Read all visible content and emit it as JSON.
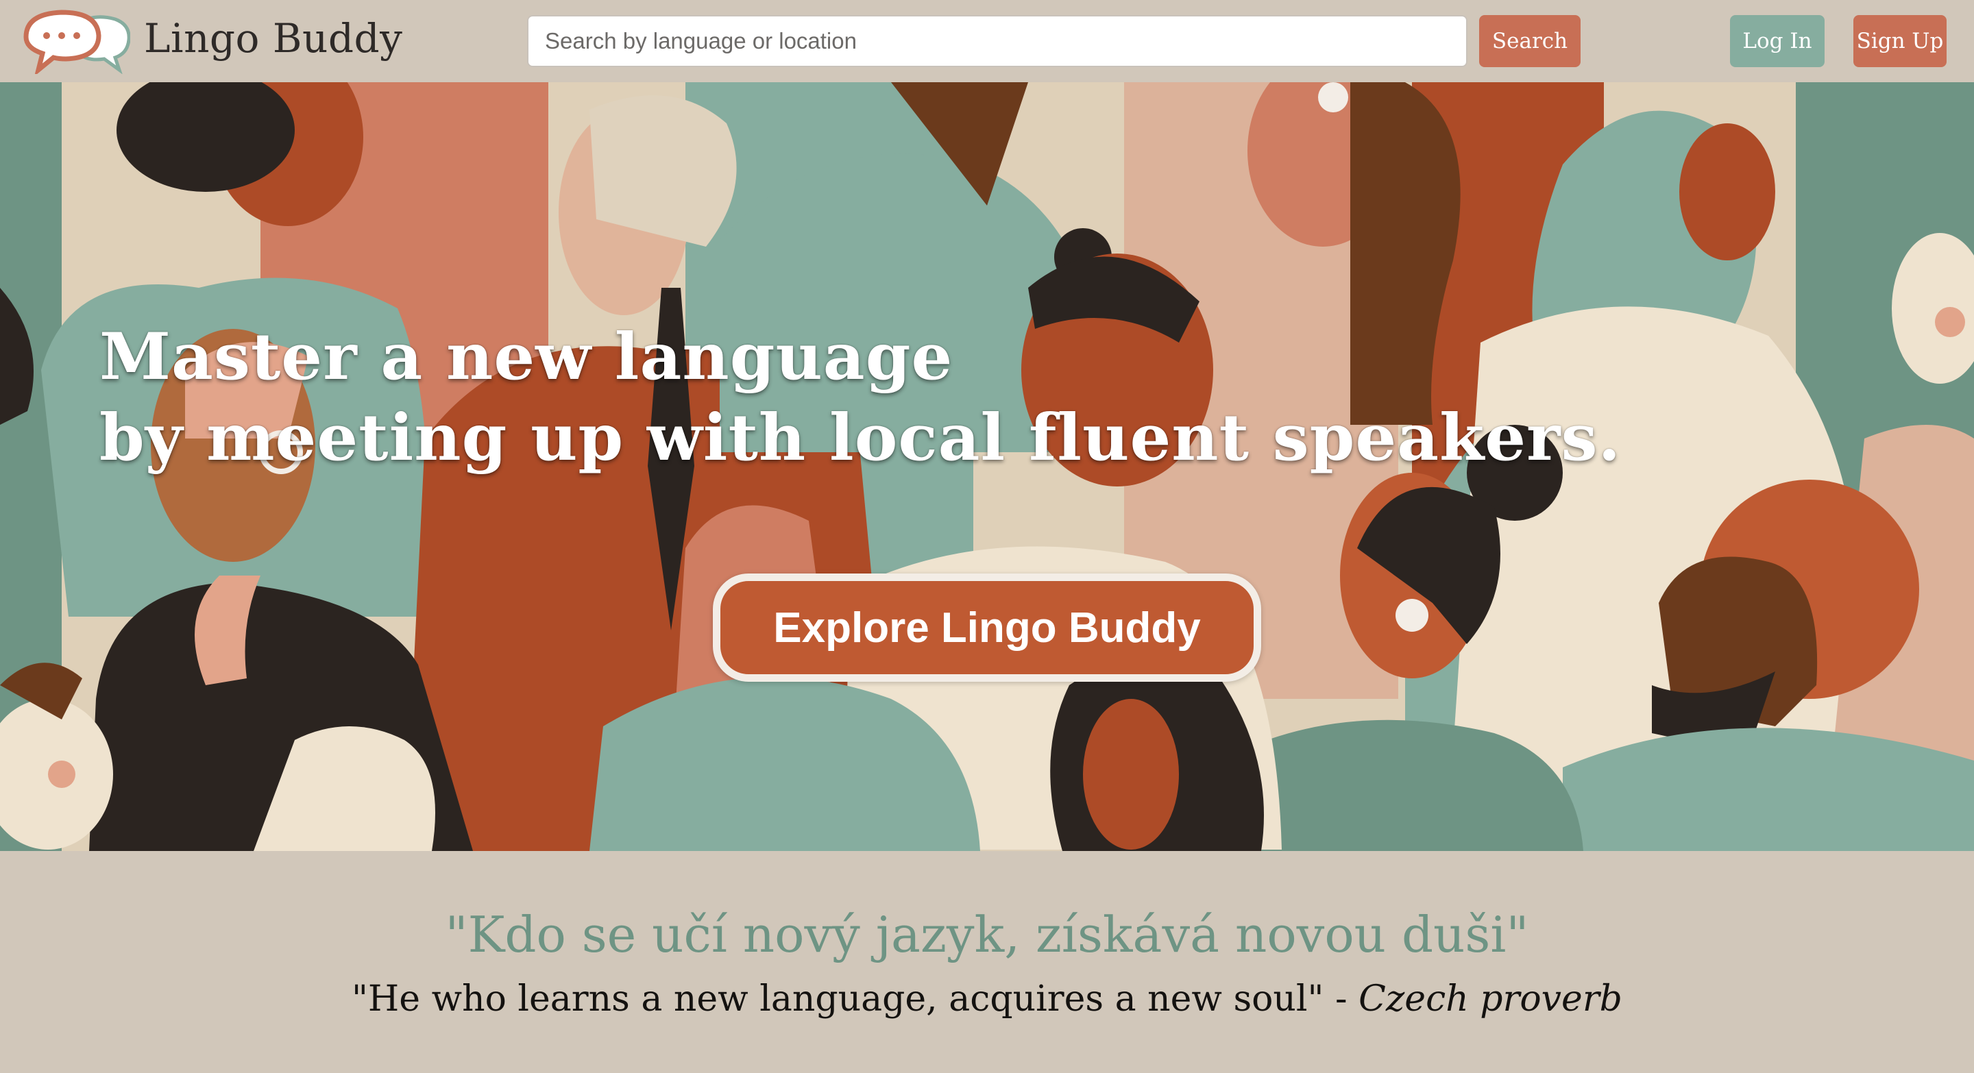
{
  "brand": {
    "name": "Lingo Buddy",
    "logo_icon": "speech-bubbles-icon"
  },
  "search": {
    "placeholder": "Search by language or location",
    "value": "",
    "button_label": "Search"
  },
  "auth": {
    "login_label": "Log In",
    "signup_label": "Sign Up"
  },
  "hero": {
    "headline_line1": "Master a new language",
    "headline_line2": "by meeting up with local fluent speakers.",
    "cta_label": "Explore Lingo Buddy"
  },
  "quote": {
    "original": "\"Kdo se učí nový jazyk, získává novou duši\"",
    "translation": "\"He who learns a new language, acquires a new soul\"",
    "separator": " - ",
    "attribution": "Czech proverb"
  },
  "colors": {
    "background": "#d1c7ba",
    "accent_terracotta": "#c86f55",
    "accent_sage": "#86ad9f",
    "cta": "#bf5a32",
    "quote_green": "#6e9484"
  }
}
